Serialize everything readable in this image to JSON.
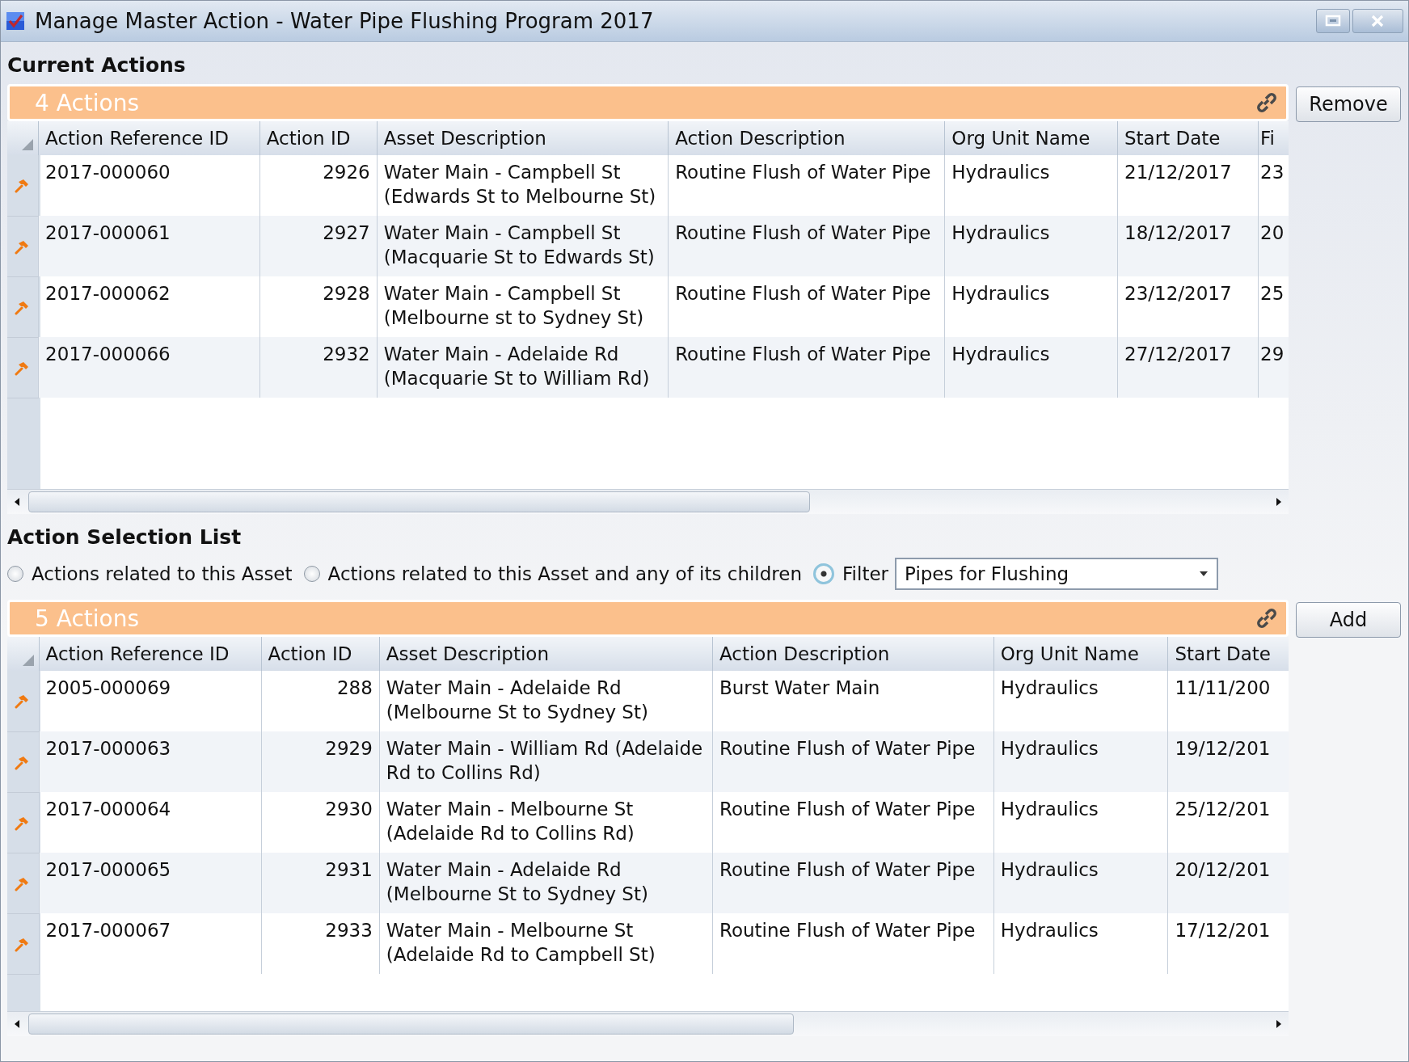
{
  "window": {
    "title": "Manage Master Action - Water Pipe Flushing Program 2017"
  },
  "current_actions": {
    "heading": "Current Actions",
    "count_label": "4 Actions",
    "button": "Remove",
    "table": {
      "columns": [
        "Action Reference ID",
        "Action ID",
        "Asset Description",
        "Action Description",
        "Org Unit Name",
        "Start Date",
        "Fi"
      ],
      "rows": [
        {
          "cells": [
            "2017-000060",
            "2926",
            "Water Main - Campbell St (Edwards St to Melbourne St)",
            "Routine Flush of Water Pipe",
            "Hydraulics",
            "21/12/2017",
            "23"
          ]
        },
        {
          "cells": [
            "2017-000061",
            "2927",
            "Water Main - Campbell St (Macquarie St to Edwards St)",
            "Routine Flush of Water Pipe",
            "Hydraulics",
            "18/12/2017",
            "20"
          ]
        },
        {
          "cells": [
            "2017-000062",
            "2928",
            "Water Main - Campbell St (Melbourne st to Sydney St)",
            "Routine Flush of Water Pipe",
            "Hydraulics",
            "23/12/2017",
            "25"
          ]
        },
        {
          "cells": [
            "2017-000066",
            "2932",
            "Water Main - Adelaide Rd (Macquarie St to William Rd)",
            "Routine Flush of Water Pipe",
            "Hydraulics",
            "27/12/2017",
            "29"
          ]
        }
      ]
    }
  },
  "action_selection": {
    "heading": "Action Selection List",
    "options": [
      {
        "label": "Actions related to this Asset",
        "selected": false
      },
      {
        "label": "Actions related to this Asset and any of its children",
        "selected": false
      },
      {
        "label": "Filter",
        "selected": true
      }
    ],
    "filter_dropdown": {
      "value": "Pipes for Flushing"
    },
    "count_label": "5 Actions",
    "button": "Add",
    "table": {
      "columns": [
        "Action Reference ID",
        "Action ID",
        "Asset Description",
        "Action Description",
        "Org Unit Name",
        "Start Date"
      ],
      "rows": [
        {
          "cells": [
            "2005-000069",
            "288",
            "Water Main - Adelaide Rd (Melbourne St to Sydney St)",
            "Burst Water Main",
            "Hydraulics",
            "11/11/200"
          ]
        },
        {
          "cells": [
            "2017-000063",
            "2929",
            "Water Main - William Rd (Adelaide Rd to Collins Rd)",
            "Routine Flush of Water Pipe",
            "Hydraulics",
            "19/12/201"
          ]
        },
        {
          "cells": [
            "2017-000064",
            "2930",
            "Water Main - Melbourne St (Adelaide Rd to Collins Rd)",
            "Routine Flush of Water Pipe",
            "Hydraulics",
            "25/12/201"
          ]
        },
        {
          "cells": [
            "2017-000065",
            "2931",
            "Water Main - Adelaide Rd (Melbourne St to Sydney St)",
            "Routine Flush of Water Pipe",
            "Hydraulics",
            "20/12/201"
          ]
        },
        {
          "cells": [
            "2017-000067",
            "2933",
            "Water Main - Melbourne St (Adelaide Rd to Campbell St)",
            "Routine Flush of Water Pipe",
            "Hydraulics",
            "17/12/201"
          ]
        }
      ]
    }
  }
}
